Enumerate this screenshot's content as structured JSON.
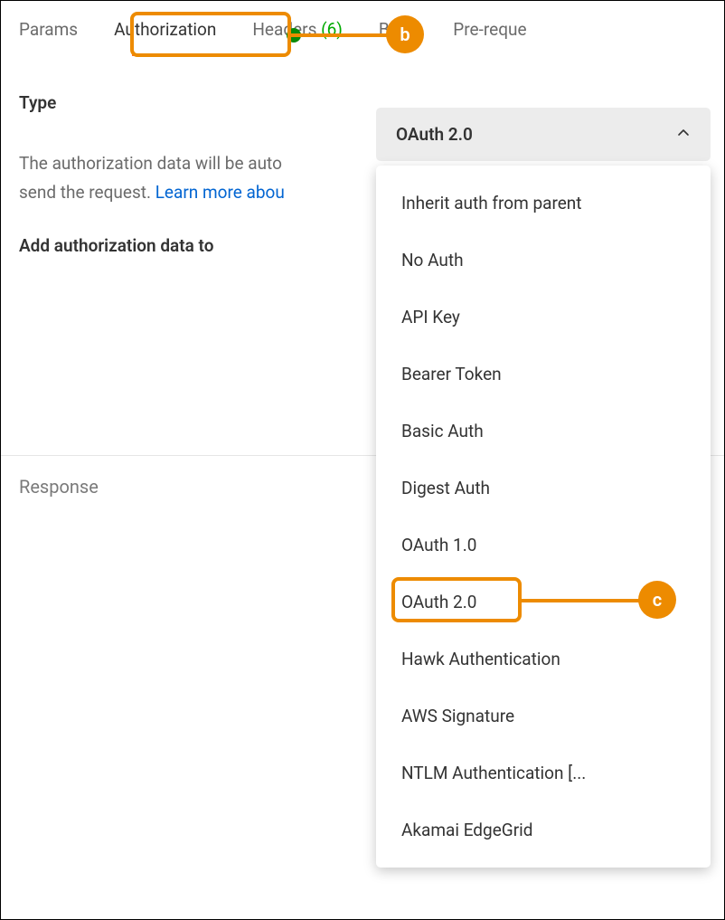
{
  "tabs": {
    "params": "Params",
    "authorization": "Authorization",
    "headers_label": "Headers",
    "headers_count": "(6)",
    "body": "Body",
    "prerequest": "Pre-reque"
  },
  "type_label": "Type",
  "type_selected": "OAuth 2.0",
  "helper_text_1": "The authorization data will be auto",
  "helper_text_2": "send the request. ",
  "learn_more": "Learn more abou",
  "add_data_label": "Add authorization data to",
  "response_label": "Response",
  "options": [
    "Inherit auth from parent",
    "No Auth",
    "API Key",
    "Bearer Token",
    "Basic Auth",
    "Digest Auth",
    "OAuth 1.0",
    "OAuth 2.0",
    "Hawk Authentication",
    "AWS Signature",
    "NTLM Authentication [...",
    "Akamai EdgeGrid"
  ],
  "callouts": {
    "b": "b",
    "c": "c"
  }
}
